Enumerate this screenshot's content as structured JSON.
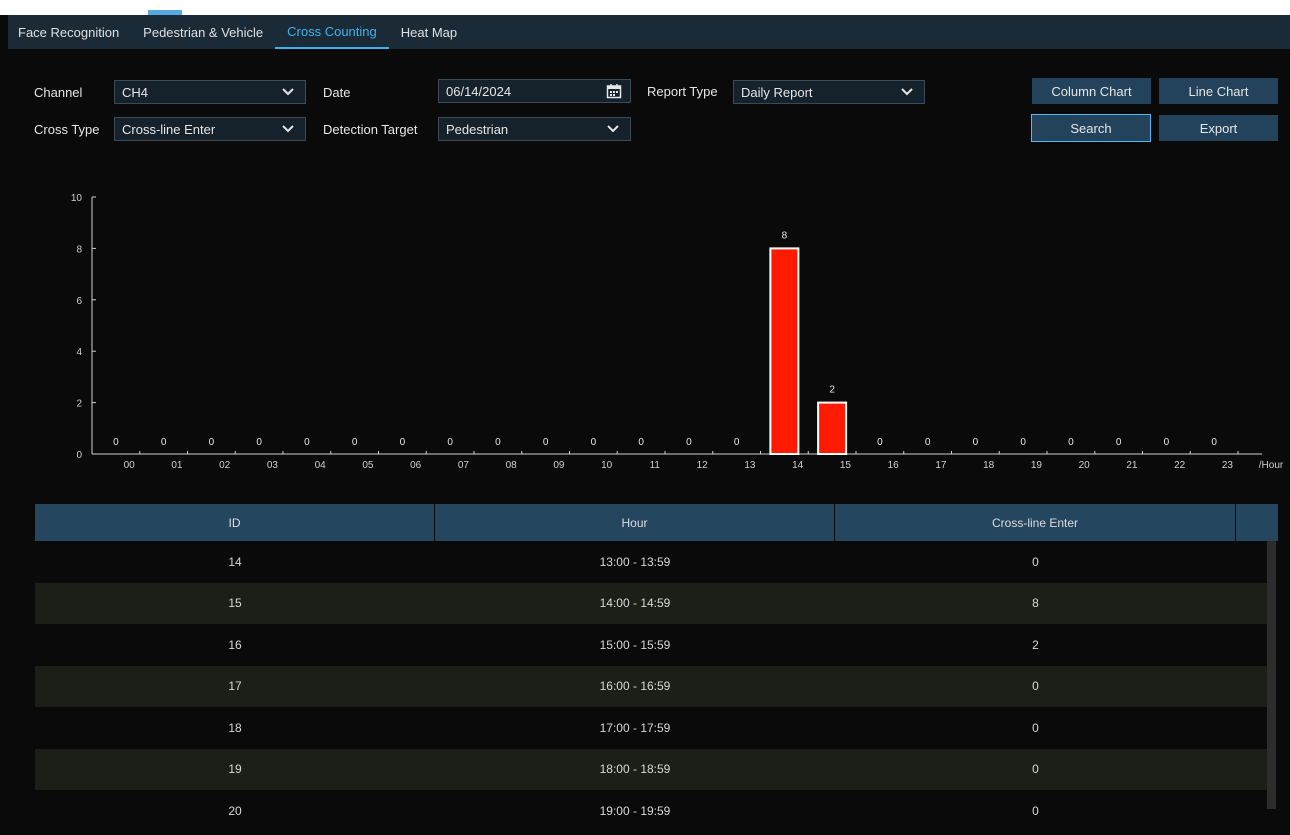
{
  "tabs": [
    {
      "label": "Face Recognition",
      "active": false
    },
    {
      "label": "Pedestrian & Vehicle",
      "active": false
    },
    {
      "label": "Cross Counting",
      "active": true
    },
    {
      "label": "Heat Map",
      "active": false
    }
  ],
  "filters": {
    "channel_label": "Channel",
    "channel_value": "CH4",
    "date_label": "Date",
    "date_value": "06/14/2024",
    "report_type_label": "Report Type",
    "report_type_value": "Daily Report",
    "cross_type_label": "Cross Type",
    "cross_type_value": "Cross-line Enter",
    "detection_target_label": "Detection Target",
    "detection_target_value": "Pedestrian"
  },
  "buttons": {
    "column_chart": "Column Chart",
    "line_chart": "Line Chart",
    "search": "Search",
    "export": "Export"
  },
  "chart_data": {
    "type": "bar",
    "categories": [
      "00",
      "01",
      "02",
      "03",
      "04",
      "05",
      "06",
      "07",
      "08",
      "09",
      "10",
      "11",
      "12",
      "13",
      "14",
      "15",
      "16",
      "17",
      "18",
      "19",
      "20",
      "21",
      "22",
      "23"
    ],
    "values": [
      0,
      0,
      0,
      0,
      0,
      0,
      0,
      0,
      0,
      0,
      0,
      0,
      0,
      0,
      8,
      2,
      0,
      0,
      0,
      0,
      0,
      0,
      0,
      0
    ],
    "x_unit": "/Hour",
    "yticks": [
      0,
      2,
      4,
      6,
      8,
      10
    ],
    "ylim": [
      0,
      10
    ],
    "bar_color": "#ff1a00",
    "grid": false,
    "legend": "none"
  },
  "table": {
    "columns": [
      "ID",
      "Hour",
      "Cross-line Enter"
    ],
    "rows": [
      {
        "id": "14",
        "hour": "13:00 - 13:59",
        "count": "0"
      },
      {
        "id": "15",
        "hour": "14:00 - 14:59",
        "count": "8"
      },
      {
        "id": "16",
        "hour": "15:00 - 15:59",
        "count": "2"
      },
      {
        "id": "17",
        "hour": "16:00 - 16:59",
        "count": "0"
      },
      {
        "id": "18",
        "hour": "17:00 - 17:59",
        "count": "0"
      },
      {
        "id": "19",
        "hour": "18:00 - 18:59",
        "count": "0"
      },
      {
        "id": "20",
        "hour": "19:00 - 19:59",
        "count": "0"
      }
    ]
  },
  "colors": {
    "accent": "#3fb3f0",
    "button": "#22435b",
    "header": "#24465e"
  }
}
